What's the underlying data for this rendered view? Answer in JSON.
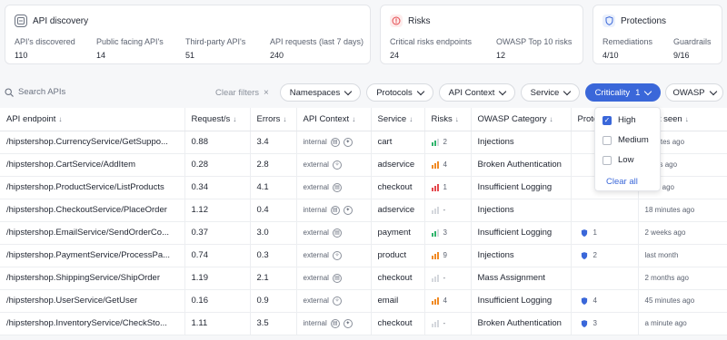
{
  "cards": {
    "discovery": {
      "title": "API discovery",
      "metrics": [
        {
          "label": "API's discovered",
          "value": "110"
        },
        {
          "label": "Public facing API's",
          "value": "14"
        },
        {
          "label": "Third-party API's",
          "value": "51"
        },
        {
          "label": "API requests (last 7 days)",
          "value": "240"
        }
      ]
    },
    "risks": {
      "title": "Risks",
      "metrics": [
        {
          "label": "Critical risks endpoints",
          "value": "24"
        },
        {
          "label": "OWASP Top 10 risks",
          "value": "12"
        }
      ]
    },
    "protections": {
      "title": "Protections",
      "metrics": [
        {
          "label": "Remediations",
          "value": "4/10"
        },
        {
          "label": "Guardrails",
          "value": "9/16"
        }
      ]
    }
  },
  "toolbar": {
    "search_placeholder": "Search APIs",
    "clear_filters": "Clear filters",
    "chips": [
      "Namespaces",
      "Protocols",
      "API Context",
      "Service",
      "Criticality",
      "OWASP"
    ],
    "criticality_count": "1"
  },
  "table": {
    "headers": [
      "API endpoint",
      "Request/s",
      "Errors",
      "API Context",
      "Service",
      "Risks",
      "OWASP Category",
      "Prote",
      "Last seen"
    ],
    "rows": [
      {
        "endpoint": "/hipstershop.CurrencyService/GetSuppo...",
        "req": "0.88",
        "err": "3.4",
        "ctx": "internal",
        "service": "cart",
        "risk": "2",
        "owasp": "Injections",
        "prot": "",
        "seen": "minutes ago"
      },
      {
        "endpoint": "/hipstershop.CartService/AddItem",
        "req": "0.28",
        "err": "2.8",
        "ctx": "external",
        "service": "adservice",
        "risk": "4",
        "owasp": "Broken Authentication",
        "prot": "",
        "seen": "hours ago"
      },
      {
        "endpoint": "/hipstershop.ProductService/ListProducts",
        "req": "0.34",
        "err": "4.1",
        "ctx": "external",
        "service": "checkout",
        "risk": "1",
        "owasp": "Insufficient Logging",
        "prot": "",
        "seen": "days ago"
      },
      {
        "endpoint": "/hipstershop.CheckoutService/PlaceOrder",
        "req": "1.12",
        "err": "0.4",
        "ctx": "internal",
        "service": "adservice",
        "risk": "-",
        "owasp": "Injections",
        "prot": "",
        "seen": "18 minutes ago"
      },
      {
        "endpoint": "/hipstershop.EmailService/SendOrderCo...",
        "req": "0.37",
        "err": "3.0",
        "ctx": "external",
        "service": "payment",
        "risk": "3",
        "owasp": "Insufficient Logging",
        "prot": "1",
        "seen": "2 weeks ago"
      },
      {
        "endpoint": "/hipstershop.PaymentService/ProcessPa...",
        "req": "0.74",
        "err": "0.3",
        "ctx": "external",
        "service": "product",
        "risk": "9",
        "owasp": "Injections",
        "prot": "2",
        "seen": "last month"
      },
      {
        "endpoint": "/hipstershop.ShippingService/ShipOrder",
        "req": "1.19",
        "err": "2.1",
        "ctx": "external",
        "service": "checkout",
        "risk": "-",
        "owasp": "Mass Assignment",
        "prot": "",
        "seen": "2 months ago"
      },
      {
        "endpoint": "/hipstershop.UserService/GetUser",
        "req": "0.16",
        "err": "0.9",
        "ctx": "external",
        "service": "email",
        "risk": "4",
        "owasp": "Insufficient Logging",
        "prot": "4",
        "seen": "45 minutes ago"
      },
      {
        "endpoint": "/hipstershop.InventoryService/CheckSto...",
        "req": "1.11",
        "err": "3.5",
        "ctx": "internal",
        "service": "checkout",
        "risk": "-",
        "owasp": "Broken Authentication",
        "prot": "3",
        "seen": "a minute ago"
      }
    ]
  },
  "criticality_menu": {
    "options": [
      {
        "label": "High",
        "checked": true
      },
      {
        "label": "Medium",
        "checked": false
      },
      {
        "label": "Low",
        "checked": false
      }
    ],
    "clear_all": "Clear all"
  },
  "colors": {
    "accent": "#3a67d9",
    "risk_green": "#2fb36b",
    "risk_orange": "#f08a24",
    "risk_red": "#e5484d"
  }
}
